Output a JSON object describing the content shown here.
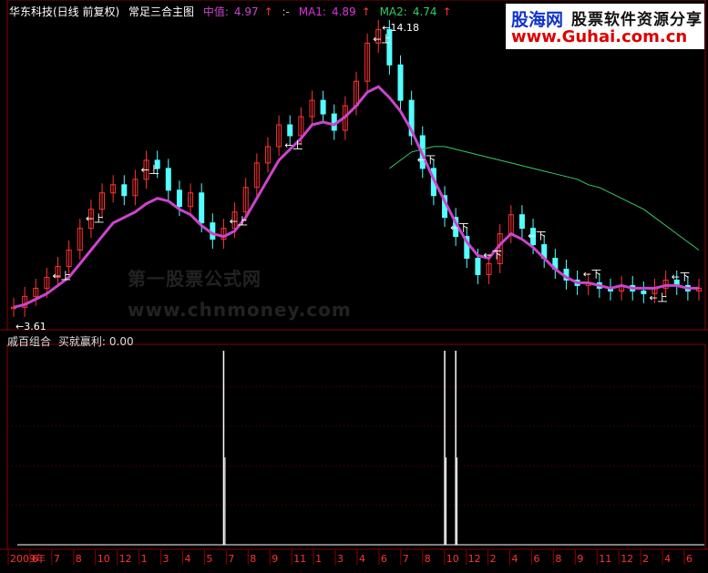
{
  "header": {
    "stock_name": "华东科技(日线 前复权)",
    "main_indicator": "常足三合主图",
    "mid_label": "中值:",
    "mid_value": "4.97",
    "mid_arrow": "↑",
    "sep": ":-",
    "ma1_label": "MA1:",
    "ma1_value": "4.89",
    "ma1_arrow": "↑",
    "ma2_label": "MA2:",
    "ma2_value": "4.74",
    "ma2_arrow": "↑"
  },
  "sub_header": {
    "indicator": "戚百组合",
    "signal_label": "买就赢利:",
    "signal_value": "0.00"
  },
  "watermark": {
    "line1": "第一股票公式网",
    "line2": "www.chnmoney.com"
  },
  "logo": {
    "brand": "股海网",
    "tagline": "股票软件资源分享",
    "url": "www.Guhai.com.cn"
  },
  "colors": {
    "background": "#000000",
    "up_candle": "#ff3333",
    "down_candle": "#55ffff",
    "mid_line": "#cc44cc",
    "ma1_line": "#dd33dd",
    "ma2_line": "#33cc66",
    "signal_bar": "#ffffff",
    "grid": "#8b0000",
    "label_text": "#ffffff"
  },
  "chart_data": [
    {
      "type": "line",
      "title": "",
      "price_range": [
        3.61,
        14.18
      ],
      "annotations": [
        {
          "text": "14.18",
          "kind": "high"
        },
        {
          "text": "3.61",
          "kind": "low"
        }
      ],
      "x_axis_labels": [
        "2009年",
        "6",
        "7",
        "8",
        "10",
        "12",
        "1",
        "3",
        "4",
        "5",
        "7",
        "8",
        "9",
        "11",
        "1",
        "3",
        "4",
        "6",
        "7",
        "8",
        "10",
        "12",
        "2",
        "4",
        "6",
        "8",
        "9",
        "11",
        "12",
        "2",
        "4",
        "6"
      ],
      "price_series": [
        3.9,
        4.3,
        4.6,
        5.0,
        5.4,
        6.0,
        6.8,
        7.5,
        8.1,
        8.4,
        8.0,
        8.6,
        9.3,
        9.0,
        8.2,
        7.6,
        8.1,
        7.0,
        6.4,
        6.8,
        7.4,
        8.3,
        9.2,
        9.8,
        10.6,
        10.2,
        10.9,
        11.5,
        11.0,
        10.4,
        11.3,
        12.2,
        13.6,
        14.1,
        12.8,
        11.5,
        10.2,
        9.0,
        8.0,
        7.2,
        6.5,
        5.7,
        5.1,
        5.5,
        6.6,
        7.3,
        6.8,
        6.2,
        5.7,
        5.3,
        4.9,
        4.7,
        4.8,
        4.6,
        4.5,
        4.7,
        4.5,
        4.4,
        4.6,
        4.9,
        4.7,
        4.5,
        4.6
      ],
      "mid_series": [
        3.9,
        4.0,
        4.2,
        4.4,
        4.7,
        5.0,
        5.5,
        6.0,
        6.5,
        7.0,
        7.2,
        7.4,
        7.7,
        7.9,
        7.8,
        7.5,
        7.3,
        6.9,
        6.6,
        6.5,
        6.7,
        7.2,
        7.9,
        8.6,
        9.3,
        9.7,
        10.1,
        10.6,
        10.7,
        10.6,
        10.9,
        11.3,
        11.8,
        12.0,
        11.6,
        11.1,
        10.4,
        9.5,
        8.6,
        7.8,
        7.0,
        6.3,
        5.8,
        5.7,
        6.2,
        6.6,
        6.4,
        6.1,
        5.7,
        5.3,
        5.0,
        4.8,
        4.8,
        4.7,
        4.6,
        4.7,
        4.6,
        4.6,
        4.6,
        4.7,
        4.7,
        4.6,
        4.6
      ],
      "ma2_series": [
        null,
        null,
        null,
        null,
        null,
        null,
        null,
        null,
        null,
        null,
        null,
        null,
        null,
        null,
        null,
        null,
        null,
        null,
        null,
        null,
        null,
        null,
        null,
        null,
        null,
        null,
        null,
        null,
        null,
        null,
        null,
        null,
        null,
        null,
        9.0,
        9.3,
        9.6,
        9.7,
        9.8,
        9.8,
        9.7,
        9.6,
        9.5,
        9.4,
        9.3,
        9.2,
        9.1,
        9.0,
        8.9,
        8.8,
        8.7,
        8.6,
        8.4,
        8.3,
        8.1,
        7.9,
        7.7,
        7.5,
        7.2,
        6.9,
        6.6,
        6.3,
        6.0
      ],
      "signals": [
        {
          "text": "上",
          "index": 4
        },
        {
          "text": "上",
          "index": 7
        },
        {
          "text": "上",
          "index": 12
        },
        {
          "text": "上",
          "index": 20
        },
        {
          "text": "上",
          "index": 25
        },
        {
          "text": "上",
          "index": 33
        },
        {
          "text": "下",
          "index": 37
        },
        {
          "text": "下",
          "index": 40
        },
        {
          "text": "下",
          "index": 43
        },
        {
          "text": "下",
          "index": 47
        },
        {
          "text": "下",
          "index": 52
        },
        {
          "text": "上",
          "index": 58
        },
        {
          "text": "下",
          "index": 60
        }
      ]
    },
    {
      "type": "bar",
      "title": "",
      "series_label": "买就赢利",
      "current_value": 0.0,
      "spikes": [
        {
          "index": 19,
          "value": 1
        },
        {
          "index": 39,
          "value": 1
        },
        {
          "index": 40,
          "value": 1
        }
      ]
    }
  ]
}
